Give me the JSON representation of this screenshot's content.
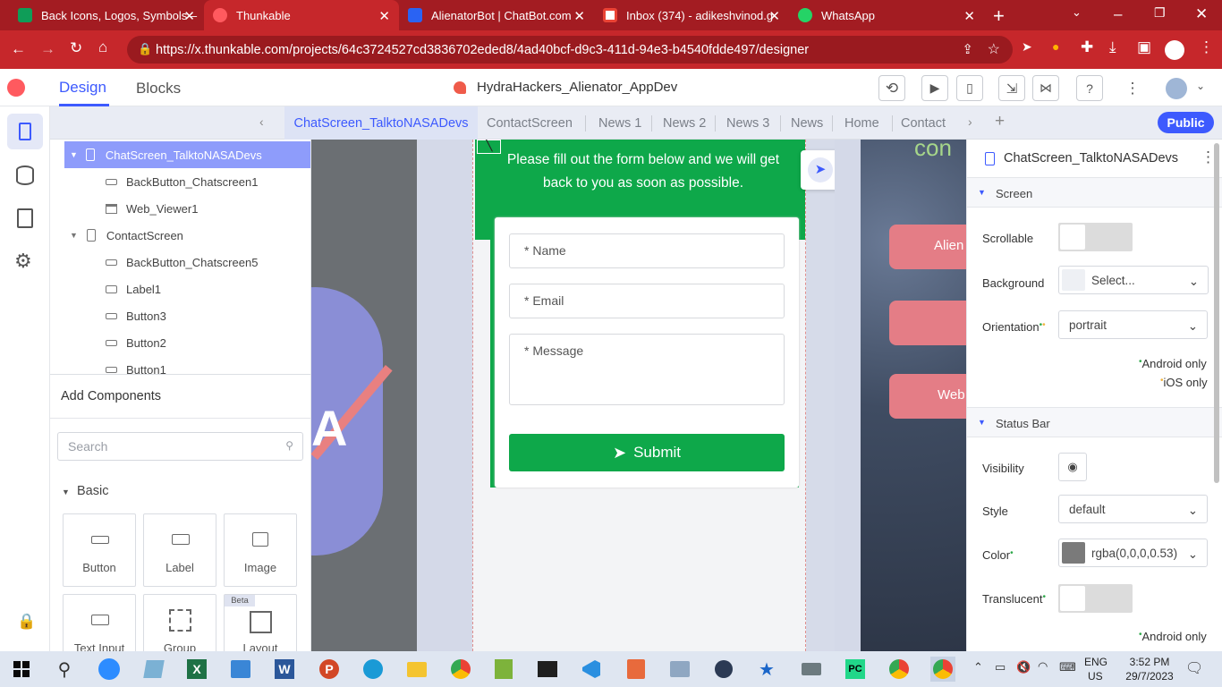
{
  "browser": {
    "tabs": [
      {
        "title": "Back Icons, Logos, Symbols –",
        "icon": "sheets-icon",
        "color": "#0f9d58"
      },
      {
        "title": "Thunkable",
        "icon": "thunkable-icon",
        "color": "#ff5a5f",
        "active": true
      },
      {
        "title": "AlienatorBot | ChatBot.com",
        "icon": "chatbot-icon",
        "color": "#2a63f3"
      },
      {
        "title": "Inbox (374) - adikeshvinod.g",
        "icon": "gmail-icon",
        "color": "#ea4335"
      },
      {
        "title": "WhatsApp",
        "icon": "whatsapp-icon",
        "color": "#25d366"
      }
    ],
    "url": "https://x.thunkable.com/projects/64c3724527cd3836702eded8/4ad40bcf-d9c3-411d-94e3-b4540fdde497/designer"
  },
  "app": {
    "design_tab": "Design",
    "blocks_tab": "Blocks",
    "project_name": "HydraHackers_Alienator_AppDev",
    "public_button": "Public",
    "accent": "#3d5afe"
  },
  "screens": [
    "ChatScreen_TalktoNASADevs",
    "ContactScreen",
    "News 1",
    "News 2",
    "News 3",
    "News",
    "Home",
    "Contact"
  ],
  "tree": [
    {
      "label": "ChatScreen_TalktoNASADevs",
      "type": "screen",
      "selected": true
    },
    {
      "label": "BackButton_Chatscreen1",
      "type": "button"
    },
    {
      "label": "Web_Viewer1",
      "type": "webviewer"
    },
    {
      "label": "ContactScreen",
      "type": "screen"
    },
    {
      "label": "BackButton_Chatscreen5",
      "type": "button"
    },
    {
      "label": "Label1",
      "type": "label"
    },
    {
      "label": "Button3",
      "type": "button"
    },
    {
      "label": "Button2",
      "type": "button"
    },
    {
      "label": "Button1",
      "type": "button"
    }
  ],
  "add_components": {
    "title": "Add Components",
    "search_placeholder": "Search",
    "section": "Basic",
    "items": [
      {
        "label": "Button",
        "icon": "button-icon"
      },
      {
        "label": "Label",
        "icon": "label-icon"
      },
      {
        "label": "Image",
        "icon": "image-icon"
      },
      {
        "label": "Text Input",
        "icon": "text-input-icon"
      },
      {
        "label": "Group",
        "icon": "group-icon"
      },
      {
        "label": "Layout",
        "icon": "layout-icon",
        "badge": "Beta"
      }
    ]
  },
  "phone": {
    "message": "Please fill out the form below and we will get back to you as soon as possible.",
    "name_placeholder": "* Name",
    "email_placeholder": "* Email",
    "message_placeholder": "* Message",
    "submit": "Submit",
    "green": "#0ea84a"
  },
  "right_preview": {
    "buttons": [
      "Alien",
      "",
      "Web"
    ],
    "heading": "con"
  },
  "properties": {
    "title": "ChatScreen_TalktoNASADevs",
    "screen_section": "Screen",
    "scrollable_label": "Scrollable",
    "background_label": "Background",
    "background_value": "Select...",
    "orientation_label": "Orientation",
    "orientation_value": "portrait",
    "android_only": "Android only",
    "ios_only": "iOS only",
    "statusbar_section": "Status Bar",
    "visibility_label": "Visibility",
    "style_label": "Style",
    "style_value": "default",
    "color_label": "Color",
    "color_value": "rgba(0,0,0,0.53)",
    "translucent_label": "Translucent",
    "android_only2": "Android only"
  },
  "taskbar": {
    "lang": "ENG",
    "region": "US",
    "time": "3:52 PM",
    "date": "29/7/2023"
  }
}
